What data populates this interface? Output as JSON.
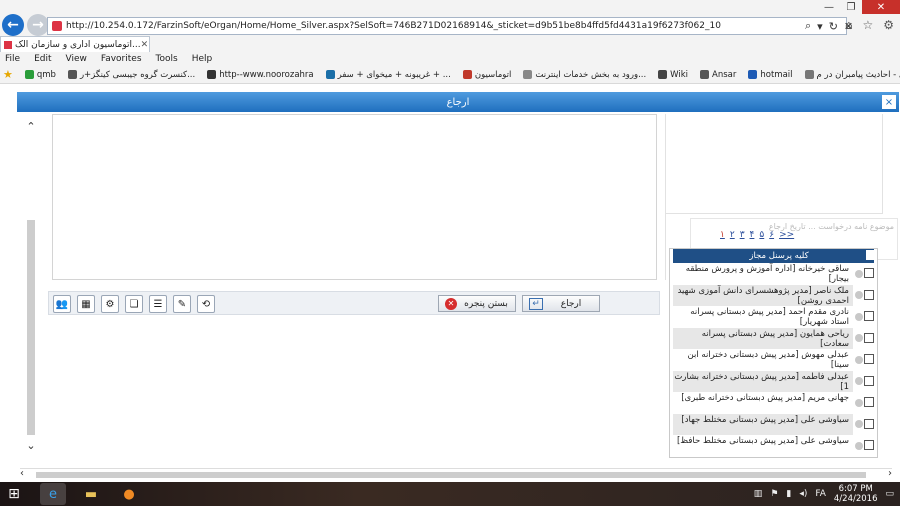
{
  "browser": {
    "url": "http://10.254.0.172/FarzinSoft/eOrgan/Home/Home_Silver.aspx?SelSoft=746B271D02168914&_sticket=d9b51be8b4ffd5fd4431a19f6273f062_10",
    "tab_title": "اتوماسیون اداری و سازمان الک...",
    "menu": [
      "File",
      "Edit",
      "View",
      "Favorites",
      "Tools",
      "Help"
    ],
    "favorites": [
      {
        "label": "qmb",
        "color": "#2a9d3a"
      },
      {
        "label": "کنسرت گروه جیبسی کینگز+ر...",
        "color": "#555555"
      },
      {
        "label": "http--www.noorozahra",
        "color": "#333333"
      },
      {
        "label": "غریبونه + میخوای + سفر + ...",
        "color": "#1b6fa8"
      },
      {
        "label": "اتوماسیون",
        "color": "#c0392b"
      },
      {
        "label": "ورود به بخش خدمات اینترنت...",
        "color": "#888888"
      },
      {
        "label": "Wiki",
        "color": "#444444"
      },
      {
        "label": "Ansar",
        "color": "#555555"
      },
      {
        "label": "hotmail",
        "color": "#1e5bb5"
      },
      {
        "label": "فاضل - احادیث پیامبران در م...",
        "color": "#777777"
      }
    ]
  },
  "dialog": {
    "title": "ارجاع",
    "close_glyph": "×",
    "buttons": {
      "close_window": "بستن پنجره",
      "refer": "ارجاع"
    },
    "pager": [
      "<<",
      "۶",
      "۵",
      "۴",
      "۳",
      "۲",
      "۱"
    ],
    "ghost_text": "موضوع نامه درخواست ... تاریخ ارجاع"
  },
  "personnel": {
    "header": "کلیه پرسنل مجاز",
    "rows": [
      "ساقی خیرخانه [اداره آموزش و پرورش منطقه بیجار]",
      "ملک ناصر [مدیر پژوهشسرای دانش آموزی شهید احمدی روشن]",
      "نادری مقدم احمد [مدیر پیش دبستانی پسرانه استاد شهریار]",
      "ریاحی همایون [مدیر پیش دبستانی پسرانه سعادت]",
      "عبدلی مهوش [مدیر پیش دبستانی دخترانه ابن سینا]",
      "عبدلی فاطمه [مدیر پیش دبستانی دخترانه بشارت 1]",
      "جهانی مریم [مدیر پیش دبستانی دخترانه طبری]",
      "سیاوشی علی [مدیر پیش دبستانی مختلط جهاد]",
      "سیاوشی علی [مدیر پیش دبستانی مختلط حافظ]"
    ]
  },
  "taskbar": {
    "lang": "FA",
    "time": "6:07 PM",
    "date": "4/24/2016"
  }
}
